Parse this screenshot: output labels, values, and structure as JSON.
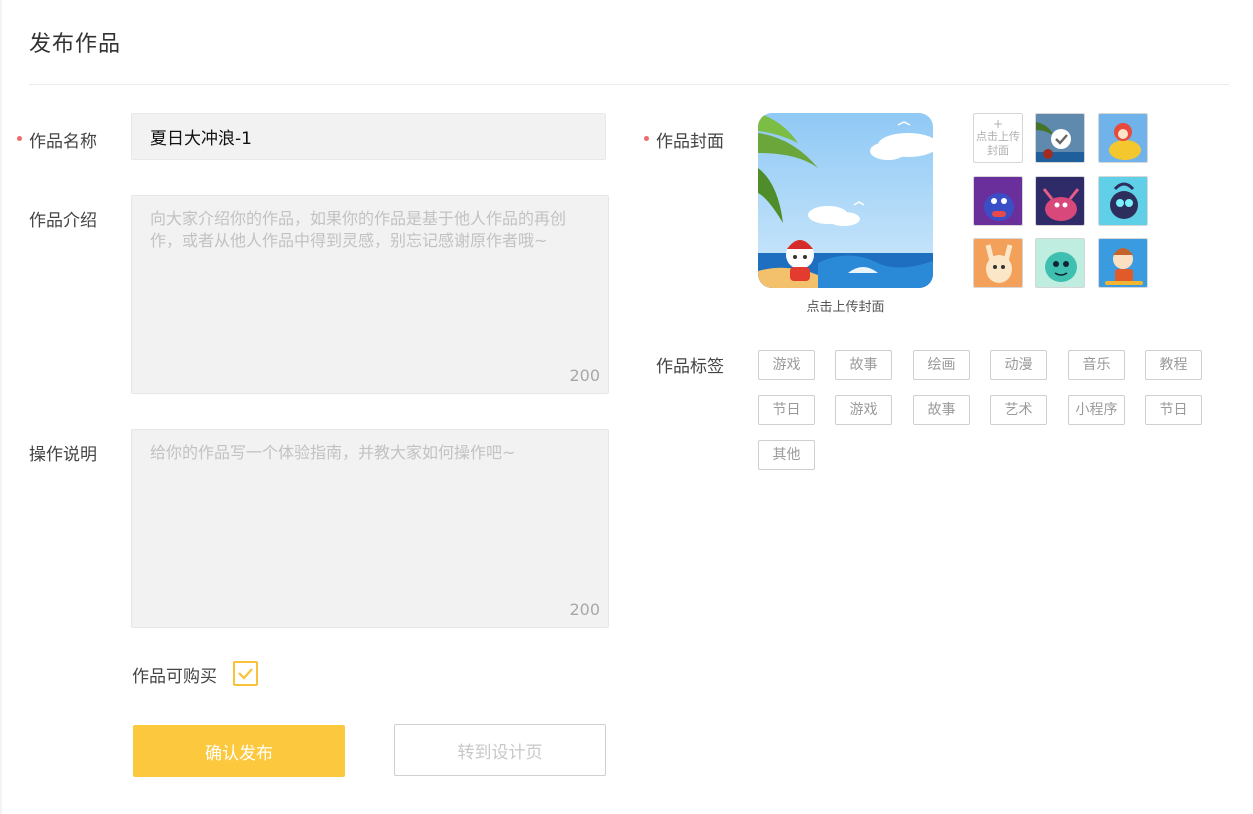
{
  "page": {
    "title": "发布作品"
  },
  "form": {
    "name": {
      "label": "作品名称",
      "value": "夏日大冲浪-1"
    },
    "intro": {
      "label": "作品介绍",
      "placeholder": "向大家介绍你的作品，如果你的作品是基于他人作品的再创作，或者从他人作品中得到灵感，别忘记感谢原作者哦~",
      "max_count": "200"
    },
    "instructions": {
      "label": "操作说明",
      "placeholder": "给你的作品写一个体验指南，并教大家如何操作吧~",
      "max_count": "200"
    },
    "buyable": {
      "label": "作品可购买",
      "checked": true
    },
    "buttons": {
      "confirm": "确认发布",
      "goto_design": "转到设计页"
    }
  },
  "cover": {
    "label": "作品封面",
    "caption": "点击上传封面",
    "upload_thumb": {
      "plus": "+",
      "text": "点击上传封面"
    }
  },
  "tags": {
    "label": "作品标签",
    "items": [
      "游戏",
      "故事",
      "绘画",
      "动漫",
      "音乐",
      "教程",
      "节日",
      "游戏",
      "故事",
      "艺术",
      "小程序",
      "节日",
      "其他"
    ]
  },
  "colors": {
    "accent": "#fcc93e",
    "required": "#ef6b6b",
    "check": "#f8c23a"
  }
}
